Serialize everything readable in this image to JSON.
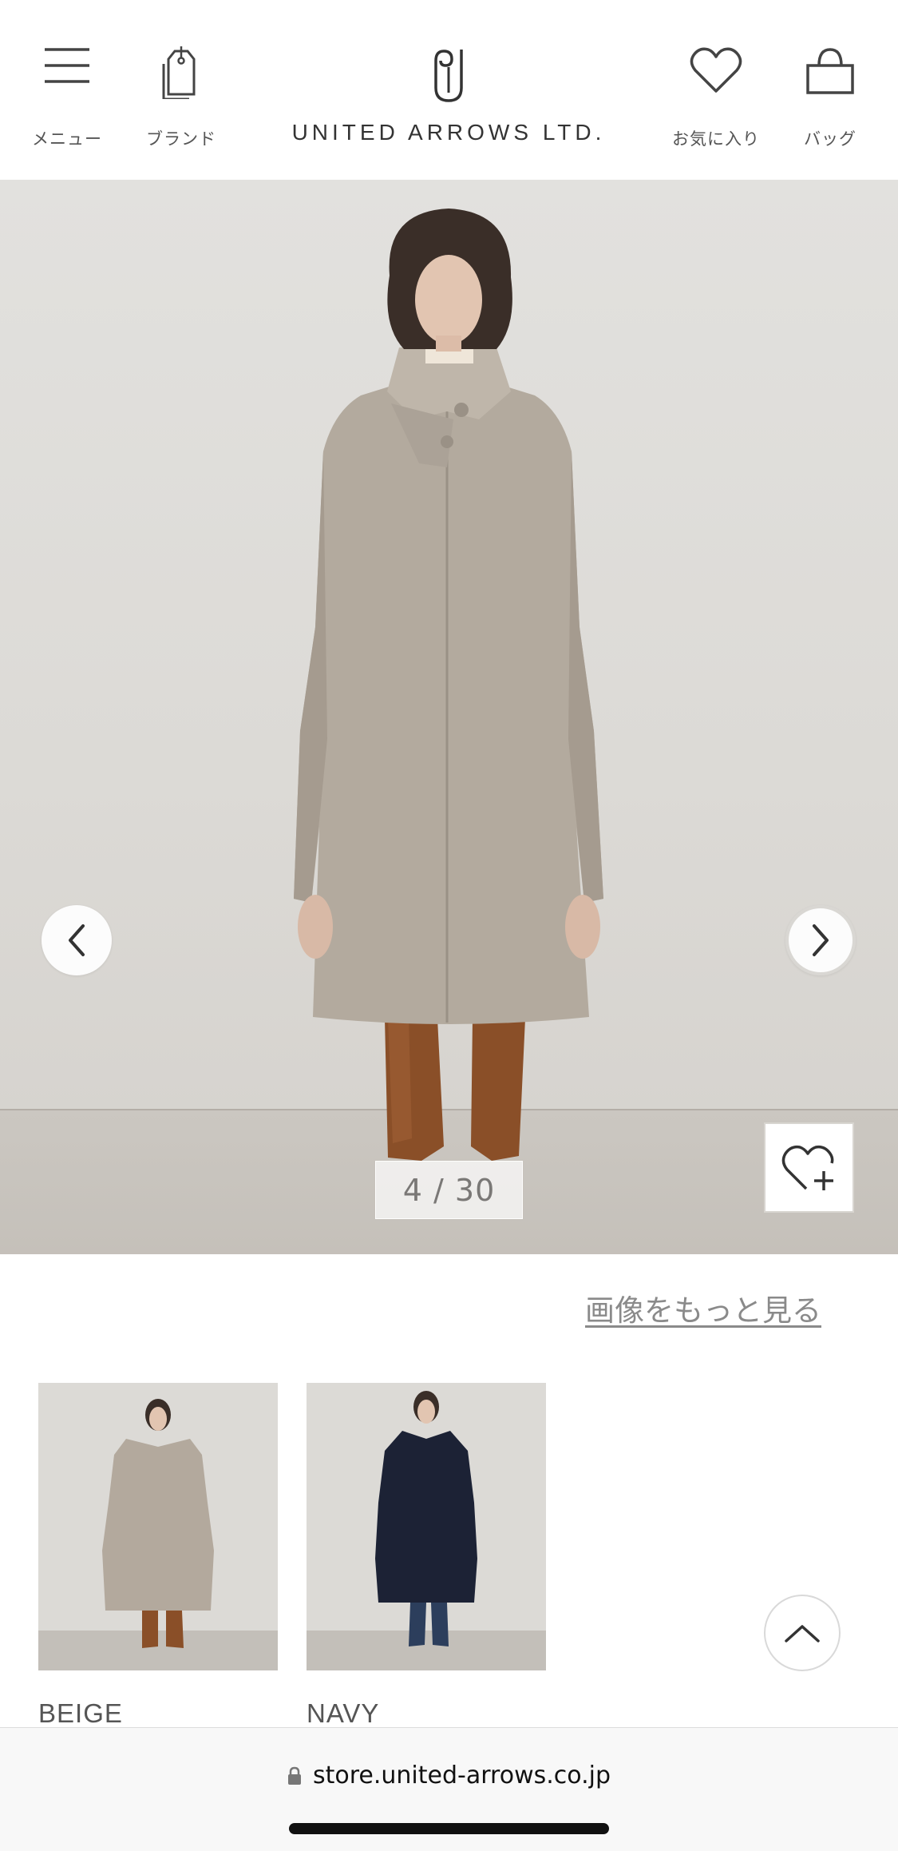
{
  "header": {
    "menu_label": "メニュー",
    "brand_label": "ブランド",
    "logo_text": "UNITED ARROWS LTD.",
    "favorites_label": "お気に入り",
    "bag_label": "バッグ"
  },
  "gallery": {
    "counter": "4 / 30",
    "more_images_link": "画像をもっと見る"
  },
  "variants": [
    {
      "color_name": "BEIGE",
      "coat_color": "#b3a99d"
    },
    {
      "color_name": "NAVY",
      "coat_color": "#1c2235"
    }
  ],
  "browser": {
    "url": "store.united-arrows.co.jp"
  },
  "icons": {
    "menu": "hamburger-icon",
    "brand": "tag-icon",
    "logo": "brand-logo-icon",
    "favorites": "heart-icon",
    "bag": "bag-icon",
    "prev": "chevron-left-icon",
    "next": "chevron-right-icon",
    "add_favorite": "heart-plus-icon",
    "scroll_top": "chevron-up-icon",
    "lock": "lock-icon"
  }
}
